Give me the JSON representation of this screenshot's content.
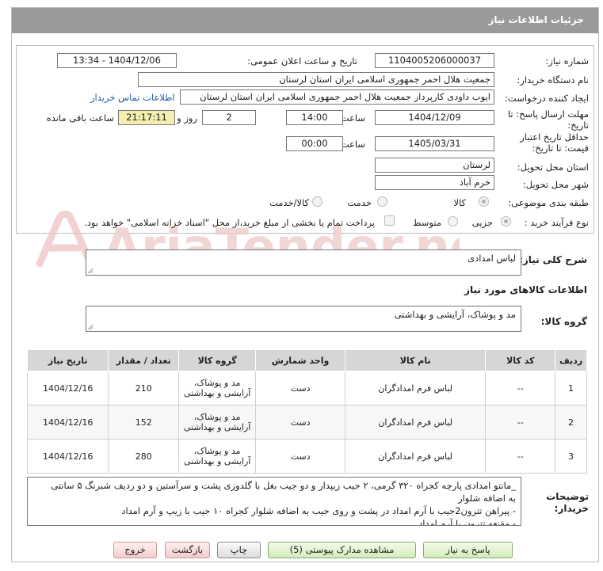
{
  "header": {
    "title": "جزئیات اطلاعات نیاز"
  },
  "form": {
    "need_number": {
      "label": "شماره نیاز:",
      "value": "1104005206000037"
    },
    "announce_datetime": {
      "label": "تاریخ و ساعت اعلان عمومی:",
      "value": "1404/12/06 - 13:34"
    },
    "buyer_org": {
      "label": "نام دستگاه خریدار:",
      "value": "جمعیت هلال احمر جمهوری اسلامی ایران استان لرستان"
    },
    "requester": {
      "label": "ایجاد کننده درخواست:",
      "value": "ایوب داودی کارپرداز جمعیت هلال احمر جمهوری اسلامی ایران استان لرستان",
      "contact_link": "اطلاعات تماس خریدار"
    },
    "deadline": {
      "label": "مهلت ارسال پاسخ: تا تاریخ:",
      "date": "1404/12/09",
      "time_label": "ساعت",
      "time": "14:00",
      "days": "2",
      "days_label": "روز و",
      "remaining": "21:17:11",
      "remaining_label": "ساعت باقی مانده"
    },
    "price_validity": {
      "label": "حداقل تاریخ اعتبار قیمت: تا تاریخ:",
      "date": "1405/03/31",
      "time_label": "ساعت",
      "time": "00:00"
    },
    "province": {
      "label": "استان محل تحویل:",
      "value": "لرستان"
    },
    "city": {
      "label": "شهر محل تحویل:",
      "value": "خرم آباد"
    },
    "category": {
      "label": "طبقه بندی موضوعی:",
      "options": [
        "کالا",
        "خدمت",
        "کالا/خدمت"
      ],
      "selected": "کالا"
    },
    "process_type": {
      "label": "نوع فرآیند خرید :",
      "options": [
        "جزیی",
        "متوسط"
      ],
      "selected": "جزیی",
      "checkbox_text": "پرداخت تمام یا بخشی از مبلغ خرید،از محل \"اسناد خزانه اسلامی\" خواهد بود."
    }
  },
  "watermark": {
    "text": "AriaTender.net"
  },
  "summary": {
    "label": "شرح کلی نیاز:",
    "value": "لباس امدادی"
  },
  "goods_info": {
    "title": "اطلاعات کالاهای مورد نیاز"
  },
  "goods_group": {
    "label": "گروه کالا:",
    "value": "مد و پوشاک، آرایشی و بهداشتی"
  },
  "table": {
    "headers": [
      "ردیف",
      "کد کالا",
      "نام کالا",
      "واحد شمارش",
      "گروه کالا",
      "تعداد / مقدار",
      "تاریخ نیاز"
    ],
    "rows": [
      [
        "1",
        "--",
        "لباس فرم امدادگران",
        "دست",
        "مد و پوشاک، آرایشی و بهداشتی",
        "210",
        "1404/12/16"
      ],
      [
        "2",
        "--",
        "لباس فرم امدادگران",
        "دست",
        "مد و پوشاک، آرایشی و بهداشتی",
        "152",
        "1404/12/16"
      ],
      [
        "3",
        "--",
        "لباس فرم امدادگران",
        "دست",
        "مد و پوشاک، آرایشی و بهداشتی",
        "280",
        "1404/12/16"
      ]
    ]
  },
  "buyer_notes": {
    "label": "توضیحات خریدار:",
    "lines": [
      "_مانتو امدادی پارچه کجراه ۳۲۰ گرمی، ۲ جیب زیپدار و دو جیب بغل با گلدوزی پشت و سرآستین و دو ردیف شبرنگ ۵ سانتی",
      "به اضافه شلوار",
      "- پیراهن تترون2جیب با آرم امداد در پشت و روی جیب به اضافه شلوار کجراه ۱۰ جیب با زیپ و آرم امداد",
      "- مقنعه تترون با آرم امداد"
    ]
  },
  "buttons": {
    "reply": "پاسخ به نیاز",
    "docs": "مشاهده مدارک پیوستی (5)",
    "print": "چاپ",
    "back": "بازگشت",
    "exit": "خروج"
  },
  "colors": {
    "header_bg": "#9a9a9a",
    "link": "#1e5aa8",
    "remaining_bg": "#f5eeb0",
    "watermark": "#e8b8b8"
  }
}
